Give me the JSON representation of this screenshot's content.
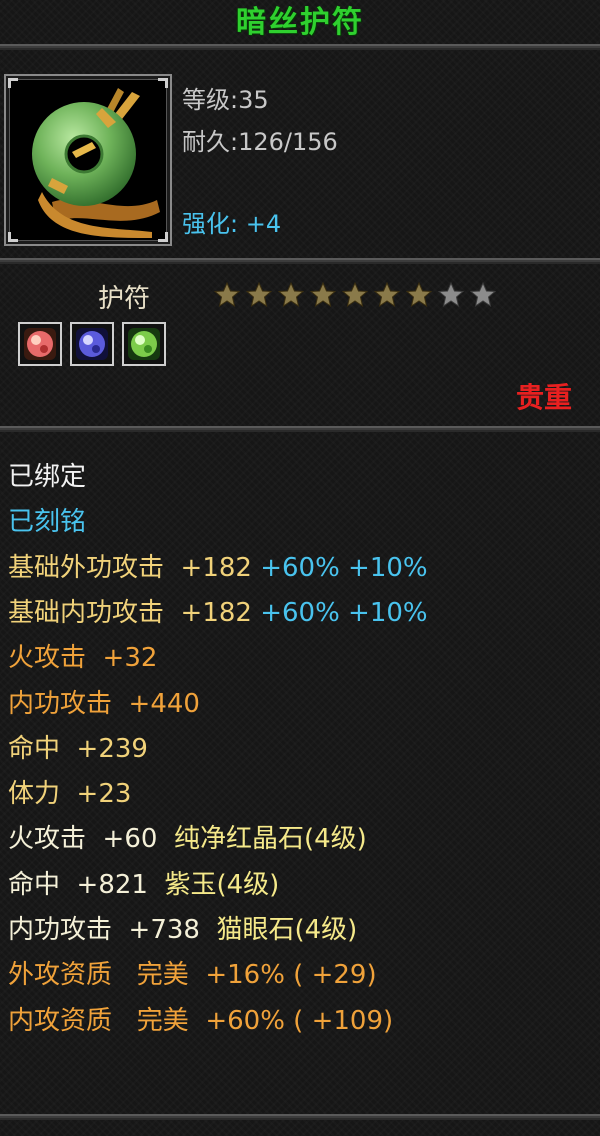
{
  "item": {
    "name": "暗丝护符",
    "level_label": "等级:35",
    "durability_label": "耐久:126/156",
    "enhance_label": "强化: +4",
    "type_label": "护符",
    "rarity_label": "贵重",
    "stars": {
      "filled": 7,
      "total": 9
    },
    "gems": [
      "red-gem-icon",
      "purple-gem-icon",
      "green-gem-icon"
    ],
    "colors": {
      "title": "#2fd02f",
      "enhance": "#49c3ee",
      "rarity": "#e82020"
    }
  },
  "attributes": [
    {
      "parts": [
        {
          "text": "已绑定",
          "color": "white"
        }
      ]
    },
    {
      "parts": [
        {
          "text": "已刻铭",
          "color": "blue"
        }
      ]
    },
    {
      "parts": [
        {
          "text": "基础外功攻击  +182 ",
          "color": "gold"
        },
        {
          "text": "+60% +10%",
          "color": "blue"
        }
      ]
    },
    {
      "parts": [
        {
          "text": "基础内功攻击  +182 ",
          "color": "gold"
        },
        {
          "text": "+60% +10%",
          "color": "blue"
        }
      ]
    },
    {
      "parts": [
        {
          "text": "火攻击  +32",
          "color": "orange"
        }
      ]
    },
    {
      "parts": [
        {
          "text": "内功攻击  +440",
          "color": "orange"
        }
      ]
    },
    {
      "parts": [
        {
          "text": "命中  +239",
          "color": "gold"
        }
      ]
    },
    {
      "parts": [
        {
          "text": "体力  +23",
          "color": "gold"
        }
      ]
    },
    {
      "parts": [
        {
          "text": "火攻击  +60  ",
          "color": "cream"
        },
        {
          "text": "纯净红晶石(4级)",
          "color": "yellow"
        }
      ]
    },
    {
      "parts": [
        {
          "text": "命中  +821  ",
          "color": "cream"
        },
        {
          "text": "紫玉(4级)",
          "color": "yellow"
        }
      ]
    },
    {
      "parts": [
        {
          "text": "内功攻击  +738  ",
          "color": "cream"
        },
        {
          "text": "猫眼石(4级)",
          "color": "yellow"
        }
      ]
    },
    {
      "parts": [
        {
          "text": "外攻资质   完美  +16% ( +29)",
          "color": "orange"
        }
      ]
    },
    {
      "parts": [
        {
          "text": "内攻资质   完美  +60% ( +109)",
          "color": "orange"
        }
      ]
    }
  ]
}
